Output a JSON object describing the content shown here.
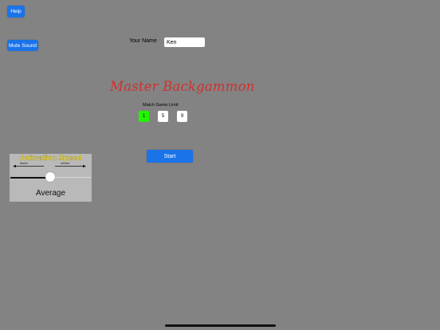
{
  "help_button": {
    "label": "Help"
  },
  "mute_button": {
    "label": "Mute Sound"
  },
  "player": {
    "name_label": "Your Name",
    "name_value": "Ken"
  },
  "game": {
    "title": "Master Backgammon",
    "match_limit_label": "Match Game Limit",
    "match_limits": [
      "1",
      "5",
      "9"
    ],
    "selected_limit": "1",
    "start_label": "Start"
  },
  "animation": {
    "title": "Animation Speed",
    "faster_label": "faster",
    "slower_label": "slower",
    "value_label": "Average",
    "slider_fraction": 0.5
  },
  "colors": {
    "background": "#838383",
    "button_blue": "#1a73e8",
    "title_red": "#d0312d",
    "selected_green": "#22f500",
    "speed_title_yellow": "#f2e04a"
  }
}
